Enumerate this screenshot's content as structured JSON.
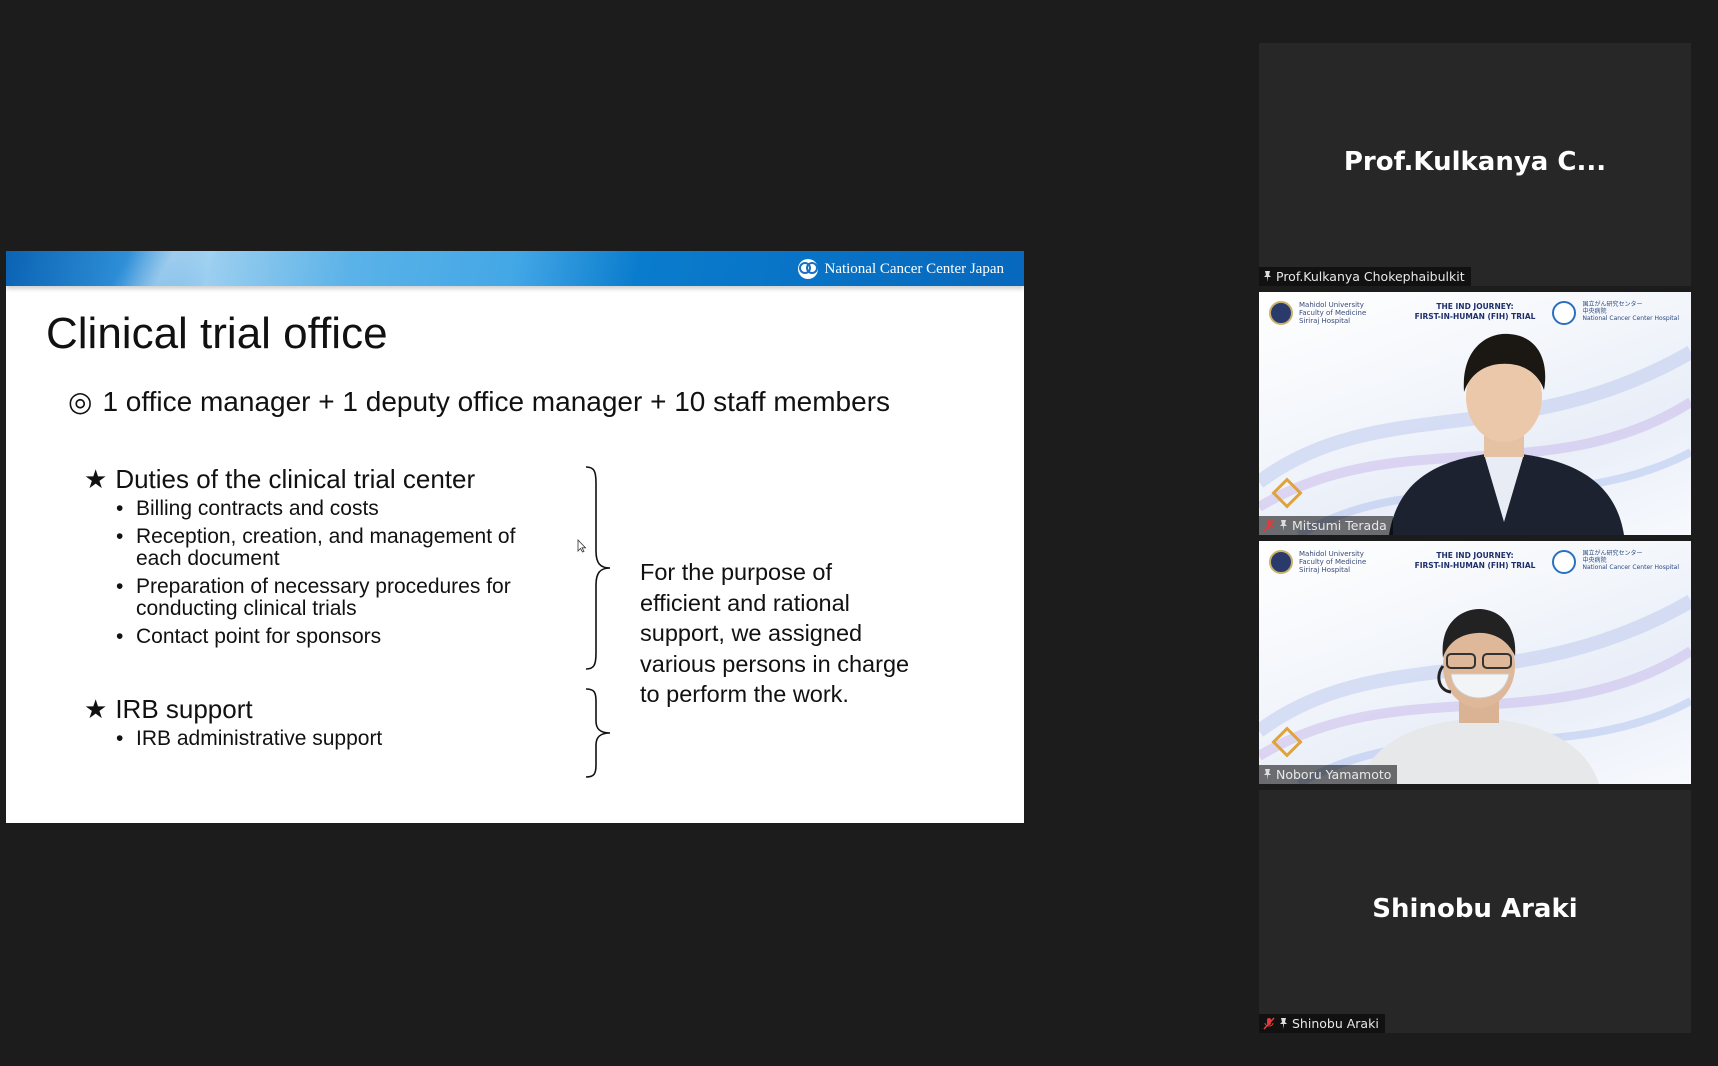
{
  "slide": {
    "org_name": "National Cancer Center Japan",
    "title": "Clinical trial office",
    "summary_mark": "◎",
    "summary": "1 office manager + 1 deputy office manager + 10 staff members",
    "section1": {
      "mark": "★",
      "heading": "Duties of the clinical trial center",
      "items": [
        "Billing contracts and costs",
        "Reception, creation, and management of each document",
        "Preparation of necessary procedures for conducting clinical trials",
        "Contact point for sponsors"
      ]
    },
    "section2": {
      "mark": "★",
      "heading": "IRB support",
      "items": [
        "IRB administrative support"
      ]
    },
    "note": "For the purpose of efficient and rational support, we assigned various persons in charge to perform the work."
  },
  "participants": [
    {
      "display_name": "Prof.Kulkanya  C...",
      "tag": "Prof.Kulkanya Chokephaibulkit",
      "video": false,
      "muted": false
    },
    {
      "tag": "Mitsumi Terada",
      "video": true,
      "muted": true,
      "bg": {
        "left_line1": "Mahidol University",
        "left_line2": "Faculty of Medicine",
        "left_line3": "Siriraj Hospital",
        "center_line1": "THE IND JOURNEY:",
        "center_line2": "FIRST-IN-HUMAN (FIH) TRIAL",
        "right_line1": "国立がん研究センター",
        "right_line2": "中央病院",
        "right_line3": "National Cancer Center Hospital"
      }
    },
    {
      "tag": "Noboru Yamamoto",
      "video": true,
      "muted": false,
      "bg": {
        "left_line1": "Mahidol University",
        "left_line2": "Faculty of Medicine",
        "left_line3": "Siriraj Hospital",
        "center_line1": "THE IND JOURNEY:",
        "center_line2": "FIRST-IN-HUMAN (FIH) TRIAL",
        "right_line1": "国立がん研究センター",
        "right_line2": "中央病院",
        "right_line3": "National Cancer Center Hospital"
      }
    },
    {
      "display_name": "Shinobu Araki",
      "tag": "Shinobu Araki",
      "video": false,
      "muted": true
    }
  ]
}
